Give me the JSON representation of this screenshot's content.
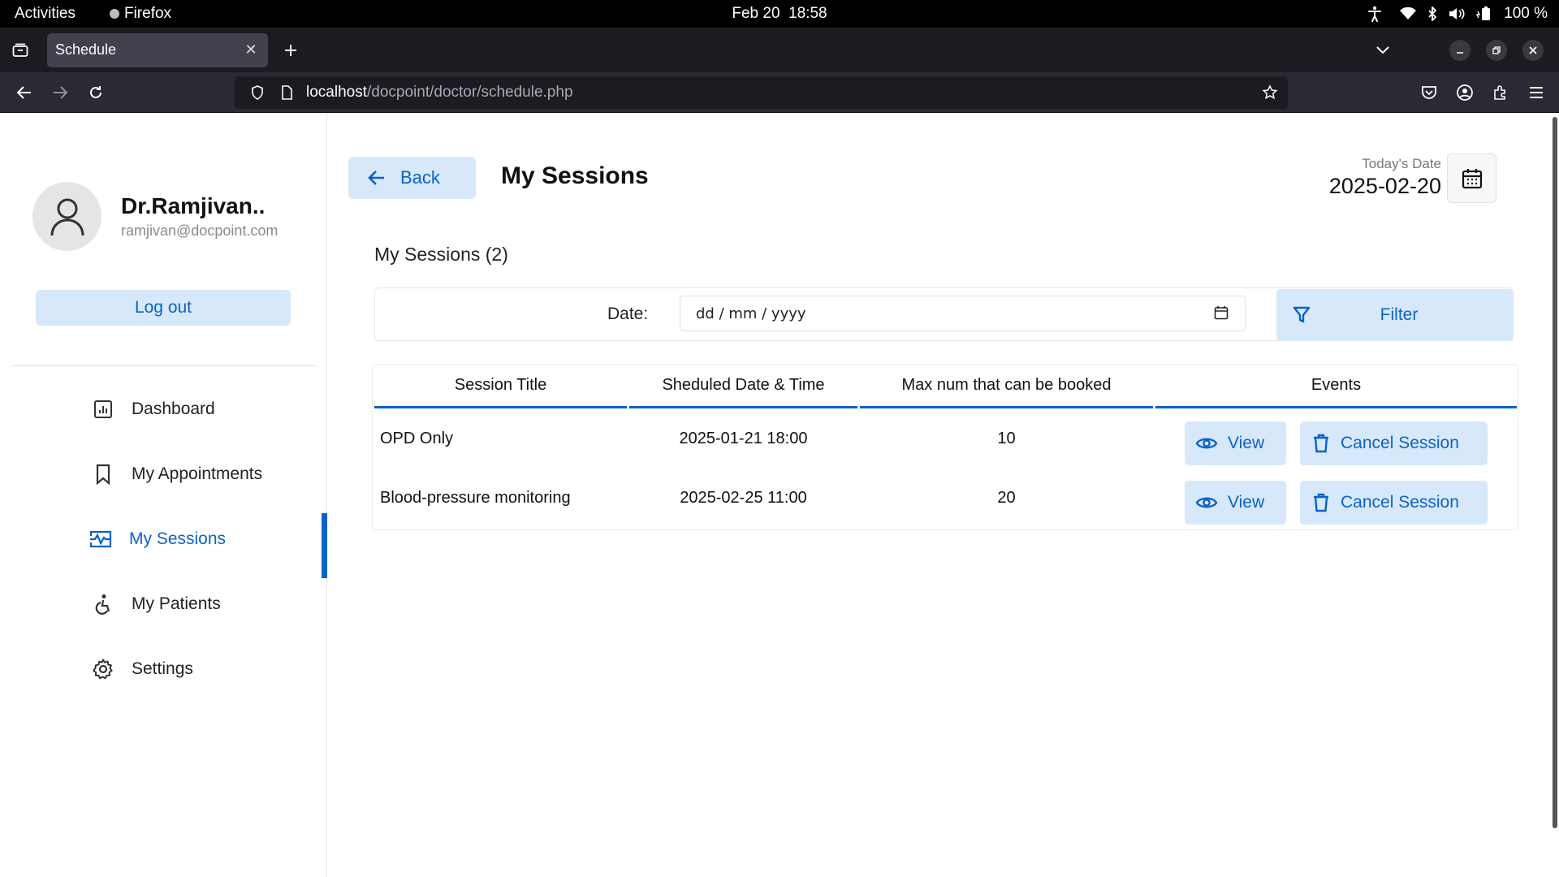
{
  "system_bar": {
    "activities": "Activities",
    "app_name": "Firefox",
    "date": "Feb 20",
    "time": "18:58",
    "battery": "100 %"
  },
  "browser": {
    "tab_title": "Schedule",
    "url_host": "localhost",
    "url_path": "/docpoint/doctor/schedule.php"
  },
  "sidebar": {
    "doctor_name": "Dr.Ramjivan..",
    "doctor_email": "ramjivan@docpoint.com",
    "logout_label": "Log out",
    "items": [
      {
        "label": "Dashboard",
        "icon": "dashboard-icon"
      },
      {
        "label": "My Appointments",
        "icon": "bookmark-icon"
      },
      {
        "label": "My Sessions",
        "icon": "sessions-icon",
        "active": true
      },
      {
        "label": "My Patients",
        "icon": "patient-icon"
      },
      {
        "label": "Settings",
        "icon": "gear-icon"
      }
    ]
  },
  "header": {
    "back_label": "Back",
    "title": "My Sessions",
    "today_label": "Today's Date",
    "today_value": "2025-02-20"
  },
  "sessions": {
    "heading": "My Sessions (2)",
    "filter": {
      "date_label": "Date:",
      "date_placeholder": "dd / mm / yyyy",
      "button_label": "Filter"
    },
    "columns": [
      "Session Title",
      "Sheduled Date & Time",
      "Max num that can be booked",
      "Events"
    ],
    "rows": [
      {
        "title": "OPD Only",
        "datetime": "2025-01-21 18:00",
        "max": "10",
        "view_label": "View",
        "cancel_label": "Cancel Session"
      },
      {
        "title": "Blood-pressure monitoring",
        "datetime": "2025-02-25 11:00",
        "max": "20",
        "view_label": "View",
        "cancel_label": "Cancel Session"
      }
    ]
  },
  "colors": {
    "accent": "#0a62c9",
    "accent_light": "#d8e8fb"
  }
}
